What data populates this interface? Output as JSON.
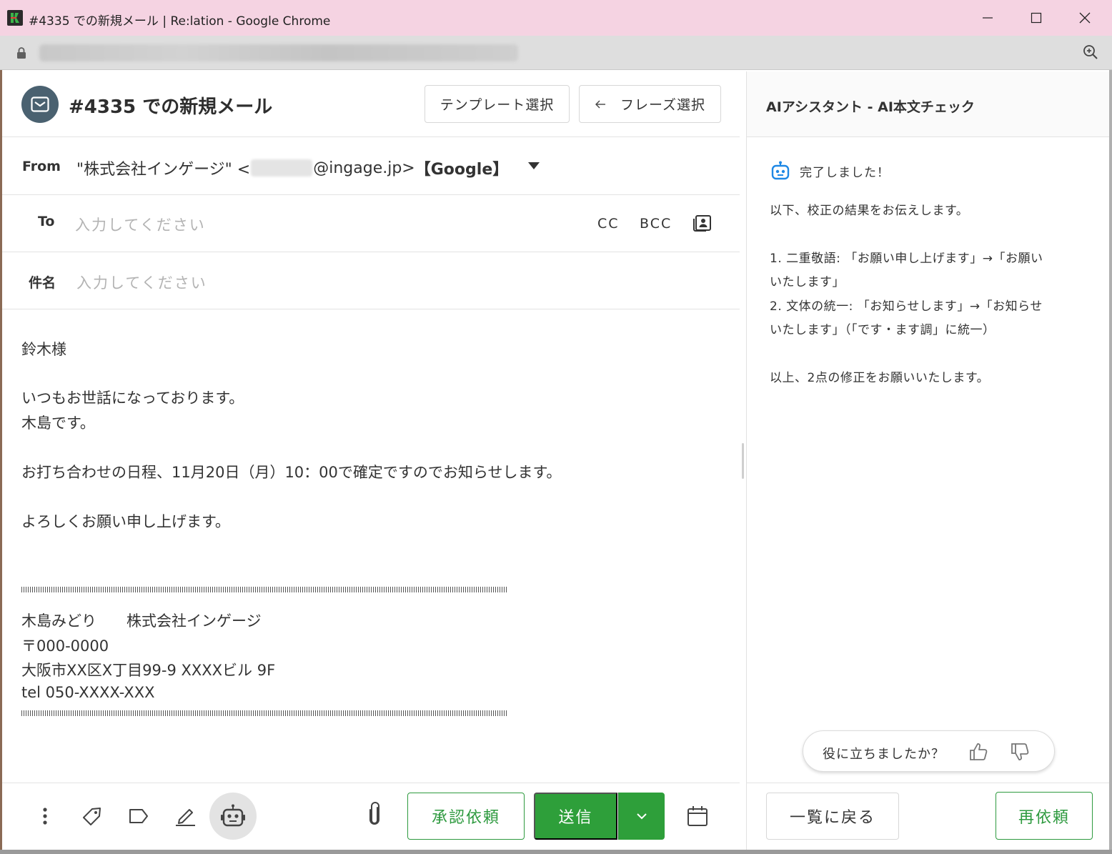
{
  "window": {
    "title": "#4335 での新規メール | Re:lation - Google Chrome",
    "min_icon": "minimize-icon",
    "max_icon": "maximize-icon",
    "close_icon": "close-icon"
  },
  "header": {
    "title": "#4335 での新規メール",
    "template_button": "テンプレート選択",
    "phrase_button": "フレーズ選択"
  },
  "from": {
    "label": "From",
    "name_part": "\"株式会社インゲージ\" <",
    "domain_part": "@ingage.jp>",
    "account_part": "【Google】"
  },
  "to": {
    "label": "To",
    "placeholder": "入力してください",
    "cc": "CC",
    "bcc": "BCC"
  },
  "subject": {
    "label": "件名",
    "placeholder": "入力してください"
  },
  "body": {
    "line1": "鈴木様",
    "line2": "いつもお世話になっております。",
    "line3": "木島です。",
    "line4": "お打ち合わせの日程、11月20日（月）10：00で確定ですのでお知らせします。",
    "line5": "よろしくお願い申し上げます。",
    "sig1": "木島みどり　　株式会社インゲージ",
    "sig2": "〒000-0000",
    "sig3": "大阪市XX区X丁目99-9 XXXXビル 9F",
    "sig4": "tel 050-XXXX-XXX"
  },
  "toolbar": {
    "approve": "承認依頼",
    "send": "送信"
  },
  "ai": {
    "title": "AIアシスタント - AI本文チェック",
    "done": "完了しました！",
    "intro": "以下、校正の結果をお伝えします。",
    "item1a": "1. 二重敬語: 「お願い申し上げます」→「お願い",
    "item1b": "いたします」",
    "item2a": "2. 文体の統一: 「お知らせします」→「お知らせ",
    "item2b": "いたします」（「です・ます調」に統一）",
    "outro": "以上、2点の修正をお願いいたします。",
    "feedback": "役に立ちましたか？",
    "back": "一覧に戻る",
    "retry": "再依頼"
  },
  "colors": {
    "titlebar": "#f5d3e2",
    "accent_green": "#2e9f3a",
    "avatar": "#4a6170",
    "ai_icon": "#1e88e5"
  }
}
